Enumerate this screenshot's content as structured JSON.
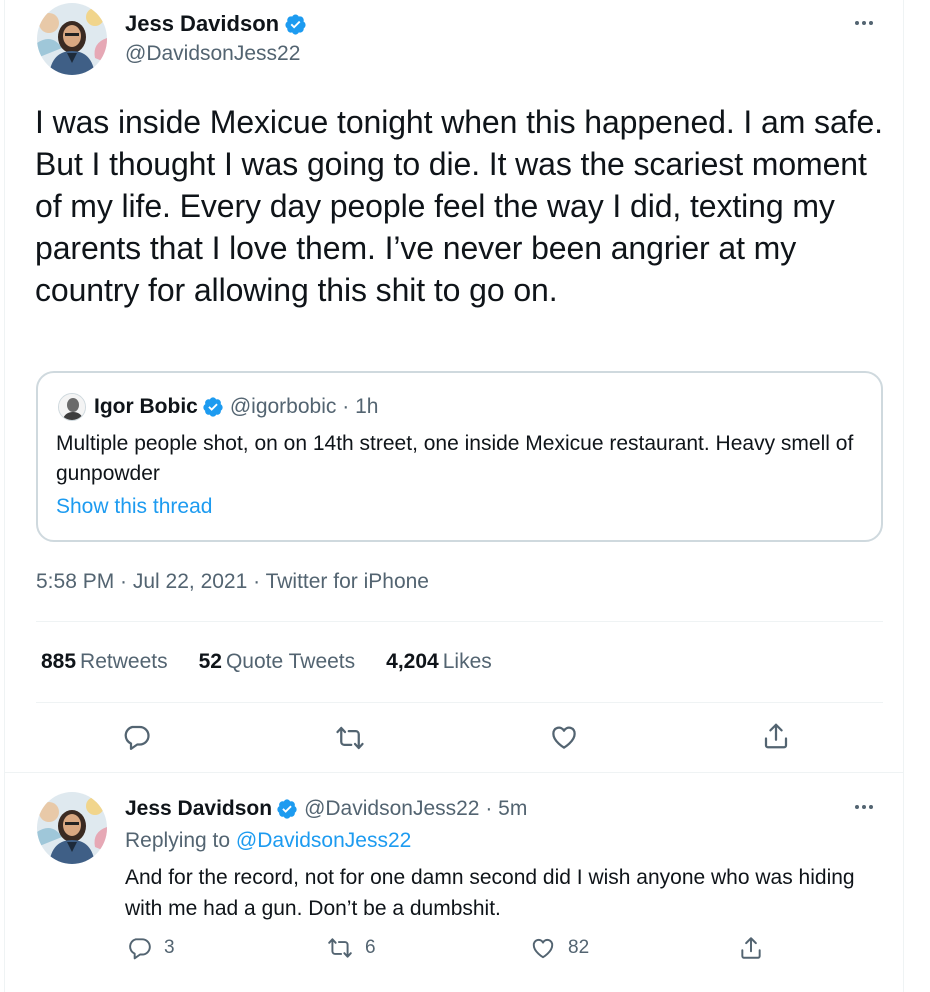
{
  "main_tweet": {
    "author_name": "Jess Davidson",
    "author_handle": "@DavidsonJess22",
    "text": "I was inside Mexicue tonight when this happened. I am safe. But I thought I was going to die. It was the scariest moment of my life. Every day people feel the way I did, texting my parents that I love them. I’ve never been angrier at my country for allowing this shit to go on.",
    "quoted": {
      "author_name": "Igor Bobic",
      "author_handle": "@igorbobic",
      "time": "1h",
      "text": "Multiple people shot, on on 14th street, one inside Mexicue restaurant. Heavy smell of gunpowder",
      "show_thread": "Show this thread"
    },
    "timestamp": "5:58 PM · Jul 22, 2021 · Twitter for iPhone",
    "stats": {
      "retweets_count": "885",
      "retweets_label": "Retweets",
      "quotes_count": "52",
      "quotes_label": "Quote Tweets",
      "likes_count": "4,204",
      "likes_label": "Likes"
    }
  },
  "reply": {
    "author_name": "Jess Davidson",
    "author_handle": "@DavidsonJess22",
    "time": "5m",
    "replying_prefix": "Replying to",
    "replying_to": "@DavidsonJess22",
    "text": "And for the record, not for one damn second did I wish anyone who was hiding with me had a gun. Don’t be a dumbshit.",
    "reply_count": "3",
    "retweet_count": "6",
    "like_count": "82"
  },
  "icons": [
    "verified-badge-icon",
    "more-icon",
    "reply-icon",
    "retweet-icon",
    "like-icon",
    "share-icon"
  ],
  "colors": {
    "accent": "#1d9bf0",
    "text": "#0f1419",
    "secondary": "#536471",
    "border": "#cfd9de"
  }
}
